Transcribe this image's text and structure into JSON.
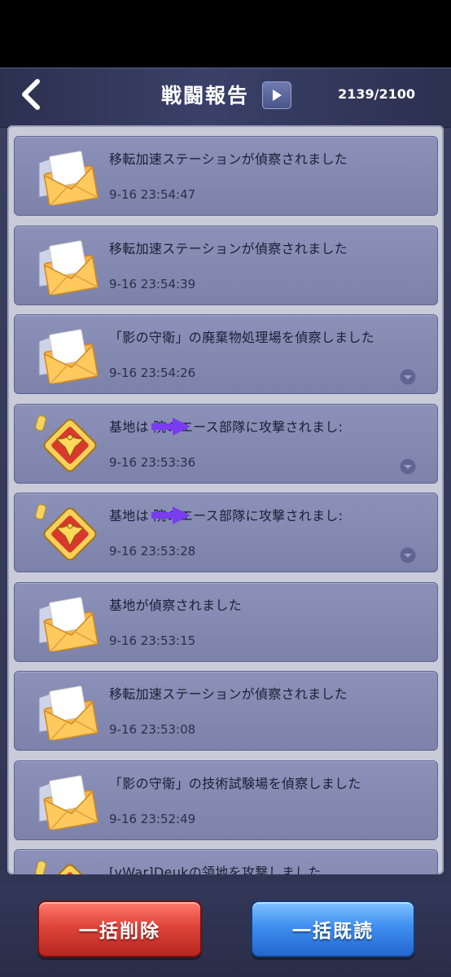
{
  "header": {
    "title": "戦闘報告",
    "count": "2139/2100"
  },
  "reports": [
    {
      "icon": "envelope-icon",
      "message": "移転加速ステーションが偵察されました",
      "time": "9-16 23:54:47",
      "expandable": false
    },
    {
      "icon": "envelope-icon",
      "message": "移転加速ステーションが偵察されました",
      "time": "9-16 23:54:39",
      "expandable": false
    },
    {
      "icon": "envelope-icon",
      "message": "「影の守衛」の廃棄物処理場を偵察しました",
      "time": "9-16 23:54:26",
      "expandable": true
    },
    {
      "icon": "eagle-emblem-icon",
      "message": "基地は     院のエース部隊に攻撃されまし:",
      "time": "9-16 23:53:36",
      "expandable": true
    },
    {
      "icon": "eagle-emblem-icon",
      "message": "基地は     院のエース部隊に攻撃されまし:",
      "time": "9-16 23:53:28",
      "expandable": true
    },
    {
      "icon": "envelope-icon",
      "message": "基地が偵察されました",
      "time": "9-16 23:53:15",
      "expandable": false
    },
    {
      "icon": "envelope-icon",
      "message": "移転加速ステーションが偵察されました",
      "time": "9-16 23:53:08",
      "expandable": false
    },
    {
      "icon": "envelope-icon",
      "message": "「影の守衛」の技術試験場を偵察しました",
      "time": "9-16 23:52:49",
      "expandable": false
    },
    {
      "icon": "eagle-emblem-icon",
      "message": "[yWar]Deukの領地を攻撃しました",
      "time": "",
      "expandable": false
    }
  ],
  "footer": {
    "delete_all_label": "一括削除",
    "read_all_label": "一括既読"
  },
  "colors": {
    "delete_button": "#e0443a",
    "read_button": "#3f8ff0",
    "redaction_arrow": "#7a3cf0"
  }
}
